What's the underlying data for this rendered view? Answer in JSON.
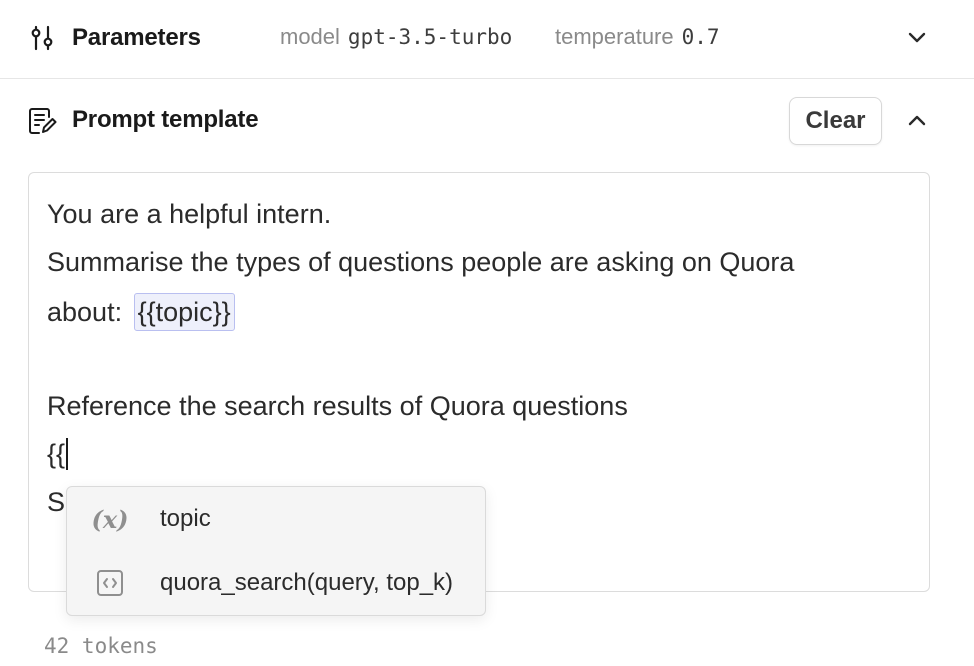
{
  "parameters": {
    "title": "Parameters",
    "model_key": "model",
    "model_value": "gpt-3.5-turbo",
    "temperature_key": "temperature",
    "temperature_value": "0.7",
    "icon": "sliders-icon",
    "toggle_icon": "chevron-down-icon"
  },
  "prompt": {
    "title": "Prompt template",
    "icon": "edit-document-icon",
    "clear_label": "Clear",
    "toggle_icon": "chevron-up-icon",
    "lines": {
      "line1": "You are a helpful intern.",
      "line2": "Summarise the types of questions people are asking on Quora",
      "line3_prefix": "about:",
      "line3_variable": "{{topic}}",
      "line5": "Reference the search results of Quora questions",
      "line6": "{{",
      "line7_partial": "S"
    }
  },
  "autocomplete": {
    "items": [
      {
        "icon": "variable-icon",
        "glyph": "(x)",
        "label": "topic"
      },
      {
        "icon": "code-function-icon",
        "label": "quora_search(query, top_k)"
      }
    ]
  },
  "footer": {
    "tokens": "42 tokens"
  },
  "colors": {
    "chip_bg": "#eef0fb",
    "chip_border": "#b9bff0",
    "muted": "#8a8a8a"
  }
}
